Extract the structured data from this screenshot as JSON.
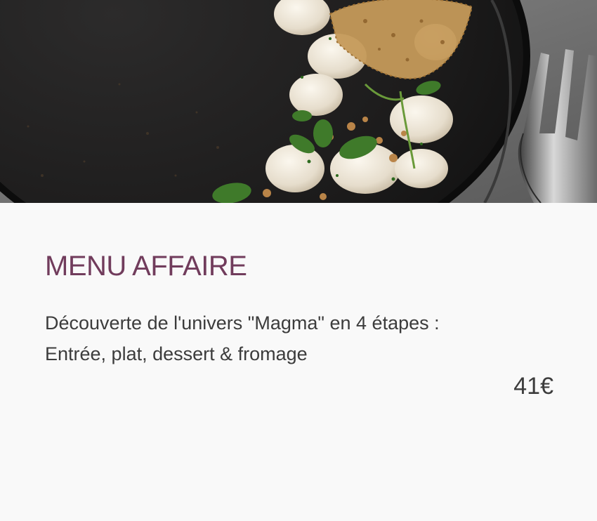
{
  "menu_card": {
    "image_alt": "Assiette de noix de Saint-Jacques crues, tuile croustillante et pousses vertes dans un bol noir, fourchette à droite",
    "title": "MENU AFFAIRE",
    "description_lines": [
      "Découverte de l'univers \"Magma\" en 4 étapes :",
      "Entrée, plat, dessert & fromage"
    ],
    "price": "41€"
  },
  "colors": {
    "title": "#713c5c",
    "text": "#3c3c3c",
    "background": "#f9f9f9"
  }
}
